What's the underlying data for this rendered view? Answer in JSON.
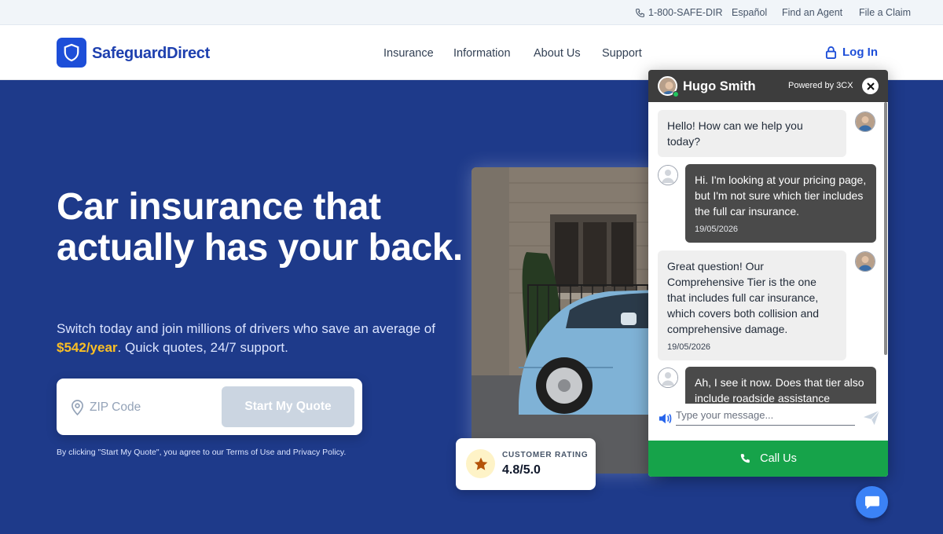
{
  "utility_bar": {
    "phone": "1-800-SAFE-DIR",
    "language": "Español",
    "find_agent": "Find an Agent",
    "file_claim": "File a Claim"
  },
  "header": {
    "brand": "SafeguardDirect",
    "nav": [
      "Insurance",
      "Information",
      "About Us",
      "Support"
    ],
    "login": "Log In"
  },
  "hero": {
    "title": "Car insurance that actually has your back.",
    "subtitle_before": "Switch today and join millions of drivers who save an average of ",
    "subtitle_highlight": "$542/year",
    "subtitle_after": ". Quick quotes, 24/7 support.",
    "zip_placeholder": "ZIP Code",
    "cta": "Start My Quote",
    "terms": "By clicking \"Start My Quote\", you agree to our Terms of Use and Privacy Policy."
  },
  "rating": {
    "label": "CUSTOMER RATING",
    "value": "4.8/5.0"
  },
  "chat": {
    "agent_name": "Hugo Smith",
    "powered_by": "Powered by 3CX",
    "messages": [
      {
        "from": "agent",
        "text": "Hello! How can we help you today?",
        "time": ""
      },
      {
        "from": "user",
        "text": "Hi. I'm looking at your pricing page, but I'm not sure which tier includes the full car insurance.",
        "time": "19/05/2026"
      },
      {
        "from": "agent",
        "text": "Great question! Our Comprehensive Tier is the one that includes full car insurance, which covers both collision and comprehensive damage.",
        "time": "19/05/2026"
      },
      {
        "from": "user",
        "text": "Ah, I see it now. Does that tier also include roadside assistance",
        "time": ""
      }
    ],
    "input_placeholder": "Type your message...",
    "call_button": "Call Us"
  },
  "colors": {
    "hero_bg": "#1e3a8a",
    "brand": "#1d4ed8",
    "accent": "#fbbf24",
    "call_green": "#16a34a"
  },
  "icons": [
    "phone-icon",
    "shield-icon",
    "lock-icon",
    "location-pin-icon",
    "star-icon",
    "close-icon",
    "speaker-icon",
    "send-icon",
    "chat-bubble-icon"
  ]
}
